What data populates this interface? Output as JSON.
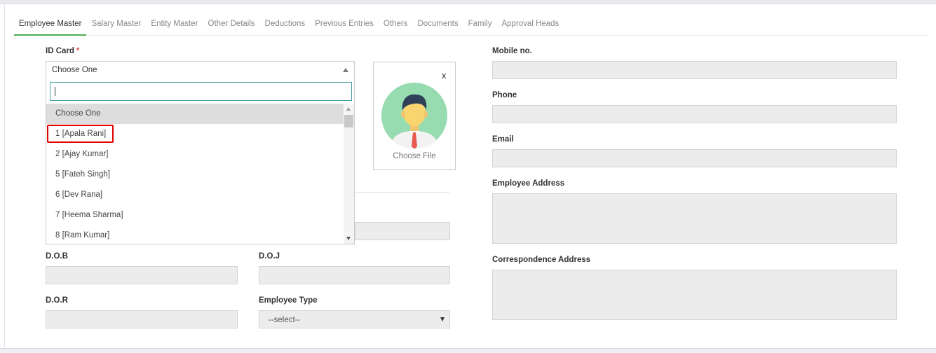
{
  "tabs": [
    {
      "label": "Employee Master",
      "active": true
    },
    {
      "label": "Salary Master",
      "active": false
    },
    {
      "label": "Entity Master",
      "active": false
    },
    {
      "label": "Other Details",
      "active": false
    },
    {
      "label": "Deductions",
      "active": false
    },
    {
      "label": "Previous Entries",
      "active": false
    },
    {
      "label": "Others",
      "active": false
    },
    {
      "label": "Documents",
      "active": false
    },
    {
      "label": "Family",
      "active": false
    },
    {
      "label": "Approval Heads",
      "active": false
    }
  ],
  "id_card": {
    "label": "ID Card",
    "required_mark": "*",
    "selected_value": "Choose One",
    "search_value": "",
    "options": [
      "Choose One",
      "1 [Apala Rani]",
      "2 [Ajay Kumar]",
      "5 [Fateh Singh]",
      "6 [Dev Rana]",
      "7 [Heema Sharma]",
      "8 [Ram Kumar]"
    ],
    "highlighted_option": "1 [Apala Rani]"
  },
  "photo": {
    "close_label": "x",
    "choose_label": "Choose File"
  },
  "form": {
    "dob_label": "D.O.B",
    "doj_label": "D.O.J",
    "dor_label": "D.O.R",
    "employee_type_label": "Employee Type",
    "employee_type_value": "--select--"
  },
  "contact": {
    "mobile_label": "Mobile no.",
    "phone_label": "Phone",
    "email_label": "Email",
    "employee_address_label": "Employee Address",
    "correspondence_address_label": "Correspondence Address"
  },
  "colors": {
    "accent": "#4caf50",
    "highlight": "#e00000",
    "field_bg": "#ececec"
  }
}
